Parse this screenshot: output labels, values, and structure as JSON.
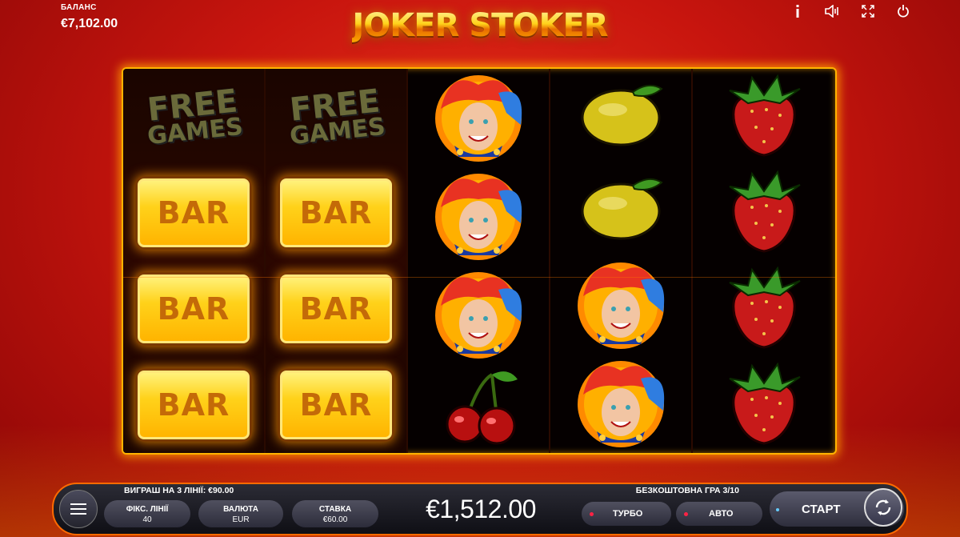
{
  "balance": {
    "label": "БАЛАНС",
    "value": "€7,102.00"
  },
  "logo": {
    "text": "JOKER STOKER"
  },
  "top_icons": [
    "info-icon",
    "sound-icon",
    "fullscreen-icon",
    "power-icon"
  ],
  "reels": [
    [
      "free-games",
      "bar",
      "bar",
      "bar"
    ],
    [
      "free-games",
      "bar",
      "bar",
      "bar"
    ],
    [
      "joker",
      "joker",
      "joker",
      "cherry"
    ],
    [
      "lemon",
      "lemon",
      "joker",
      "joker"
    ],
    [
      "strawberry",
      "strawberry",
      "strawberry",
      "strawberry"
    ]
  ],
  "symbols": {
    "bar_text": "BAR",
    "free_line1": "FREE",
    "free_line2": "GAMES"
  },
  "panel": {
    "win_text": "ВИГРАШ НА 3 ЛІНІЇ: €90.00",
    "free_game_text": "БЕЗКОШТОВНА ГРА 3/10",
    "lines_label": "ФІКС. ЛІНІЇ",
    "lines_value": "40",
    "currency_label": "ВАЛЮТА",
    "currency_value": "EUR",
    "bet_label": "СТАВКА",
    "bet_value": "€60.00",
    "win_amount": "€1,512.00",
    "turbo_label": "ТУРБО",
    "auto_label": "АВТО",
    "start_label": "СТАРТ"
  },
  "colors": {
    "accent": "#ffb300",
    "background": "#c8150e",
    "panel": "#1a1a22",
    "indicator": "#ff2244"
  }
}
